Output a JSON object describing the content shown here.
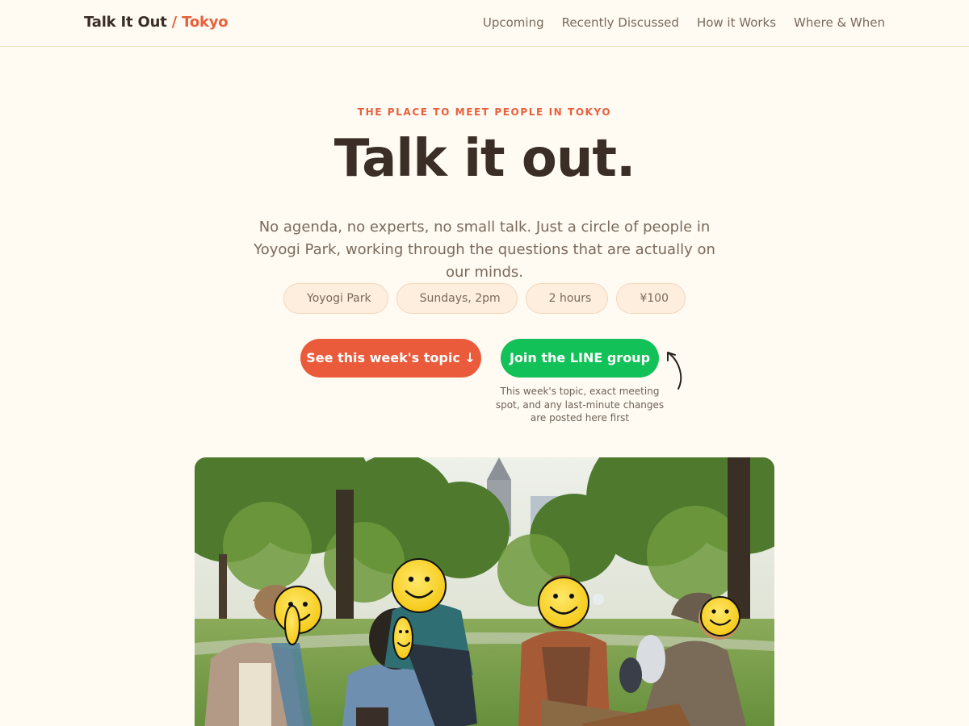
{
  "nav": {
    "brand_main": "Talk It Out",
    "brand_sep": " / ",
    "brand_city": "Tokyo",
    "links": [
      "Upcoming",
      "Recently Discussed",
      "How it Works",
      "Where & When"
    ]
  },
  "hero": {
    "eyebrow": "THE PLACE TO MEET PEOPLE IN TOKYO",
    "headline": "Talk it out.",
    "lede": "No agenda, no experts, no small talk. Just a circle of people in Yoyogi Park, working through the questions that are actually on our minds.",
    "pills": [
      "Yoyogi Park",
      "Sundays, 2pm",
      "2 hours",
      "¥100"
    ],
    "topic_button": "See this week's topic ↓",
    "line_button": "Join the LINE group",
    "line_note": "This week's topic, exact meeting spot, and any last-minute changes are posted here first"
  },
  "colors": {
    "accent": "#ea5b3c",
    "line_green": "#12c157",
    "background": "#fffaf2",
    "text": "#3a2e26",
    "muted": "#7a6a5c"
  },
  "photo": {
    "icons": [
      "arrow-curved-icon",
      "smiley-face-icon"
    ]
  }
}
